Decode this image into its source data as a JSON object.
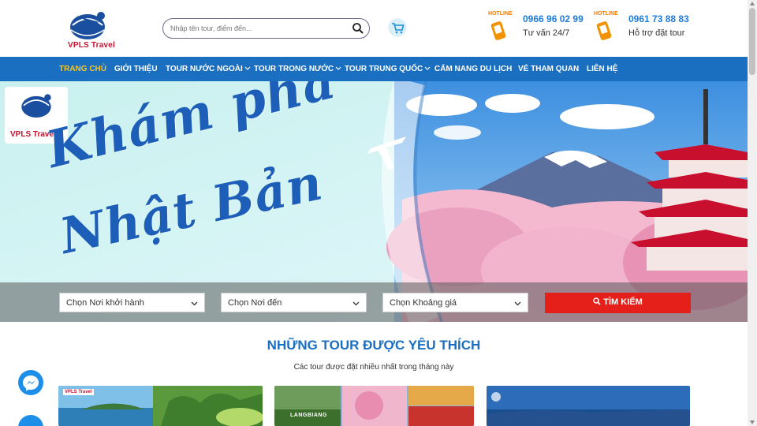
{
  "brand": {
    "name": "VPLS Travel"
  },
  "search": {
    "placeholder": "Nhập tên tour, điểm đến..."
  },
  "hotlines": [
    {
      "label": "HOTLINE",
      "number": "0966 96 02 99",
      "desc": "Tư vấn 24/7"
    },
    {
      "label": "HOTLINE",
      "number": "0961 73 88 83",
      "desc": "Hỗ trợ đặt tour"
    }
  ],
  "nav": {
    "items": [
      {
        "label": "TRANG CHỦ",
        "active": true
      },
      {
        "label": "GIỚI THIỆU"
      },
      {
        "label": "TOUR NƯỚC NGOÀI",
        "dropdown": true
      },
      {
        "label": "TOUR TRONG NƯỚC",
        "dropdown": true
      },
      {
        "label": "TOUR TRUNG QUỐC",
        "dropdown": true
      },
      {
        "label": "CẨM NANG DU LỊCH"
      },
      {
        "label": "VÉ THAM QUAN"
      },
      {
        "label": "LIÊN HỆ"
      }
    ]
  },
  "hero": {
    "title_line1": "Khám phá",
    "title_line2": "Nhật Bản"
  },
  "filters": {
    "departure": "Chọn Nơi khởi hành",
    "destination": "Chọn Nơi đến",
    "price": "Chọn Khoảng giá",
    "search_button": "TÌM KIẾM"
  },
  "section": {
    "title": "NHỮNG TOUR ĐƯỢC YÊU THÍCH",
    "subtitle": "Các tour được đặt nhiều nhất trong tháng này"
  },
  "cards": [
    {
      "label": ""
    },
    {
      "label": "LANGBIANG"
    },
    {
      "label": ""
    }
  ],
  "colors": {
    "nav_bg": "#1a6fc1",
    "nav_active": "#f7c325",
    "search_button": "#e5201a",
    "section_title": "#1a6fc1",
    "hotline_number": "#1f7bd8"
  },
  "icons": {
    "search": "search-icon",
    "cart": "cart-icon",
    "phone": "phone-icon",
    "messenger": "messenger-icon",
    "chevron": "chevron-down-icon"
  }
}
